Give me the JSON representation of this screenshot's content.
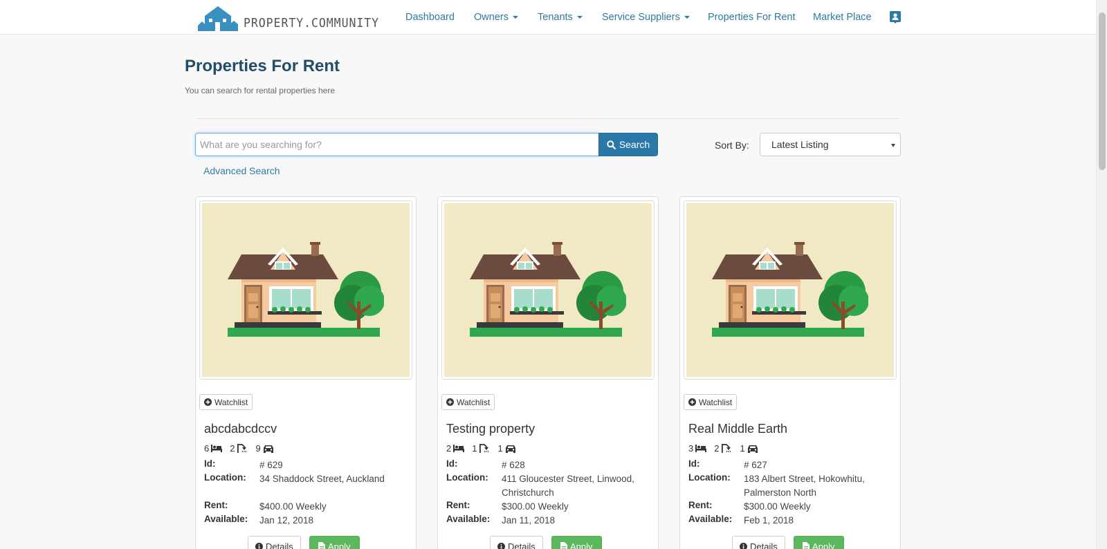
{
  "brand": {
    "name": "PROPERTY.COMMUNITY",
    "logo_icon": "house-logo-icon",
    "color": "#3a8fc1"
  },
  "nav": {
    "items": [
      {
        "label": "Dashboard"
      },
      {
        "label": "Owners"
      },
      {
        "label": "Tenants"
      },
      {
        "label": "Service Suppliers"
      },
      {
        "label": "Properties For Rent"
      },
      {
        "label": "Market Place"
      }
    ],
    "profile_icon": "user-card-icon"
  },
  "page": {
    "title": "Properties For Rent",
    "subtitle": "You can search for rental properties here"
  },
  "search": {
    "placeholder": "What are you searching for?",
    "value": "",
    "button_label": "Search",
    "advanced_label": "Advanced Search"
  },
  "sort": {
    "label": "Sort By:",
    "selected": "Latest Listing"
  },
  "card_labels": {
    "watchlist": "Watchlist",
    "id": "Id:",
    "location": "Location:",
    "rent": "Rent:",
    "available": "Available:",
    "details": "Details",
    "apply": "Apply"
  },
  "listings": [
    {
      "title": "abcdabcdccv",
      "beds": "6",
      "baths": "2",
      "parking": "9",
      "id": "# 629",
      "location": "34 Shaddock Street, Auckland",
      "rent": "$400.00 Weekly",
      "available": "Jan 12, 2018"
    },
    {
      "title": "Testing property",
      "beds": "2",
      "baths": "1",
      "parking": "1",
      "id": "# 628",
      "location": "411 Gloucester Street, Linwood, Christchurch",
      "rent": "$300.00 Weekly",
      "available": "Jan 11, 2018"
    },
    {
      "title": "Real Middle Earth",
      "beds": "3",
      "baths": "2",
      "parking": "1",
      "id": "# 627",
      "location": "183 Albert Street, Hokowhitu, Palmerston North",
      "rent": "$300.00 Weekly",
      "available": "Feb 1, 2018"
    }
  ],
  "colors": {
    "link": "#2e7aa3",
    "title": "#1f4e66",
    "search_button": "#2a78a8",
    "apply_button": "#5cb85c",
    "thumbnail_bg": "#f1e8c4"
  }
}
